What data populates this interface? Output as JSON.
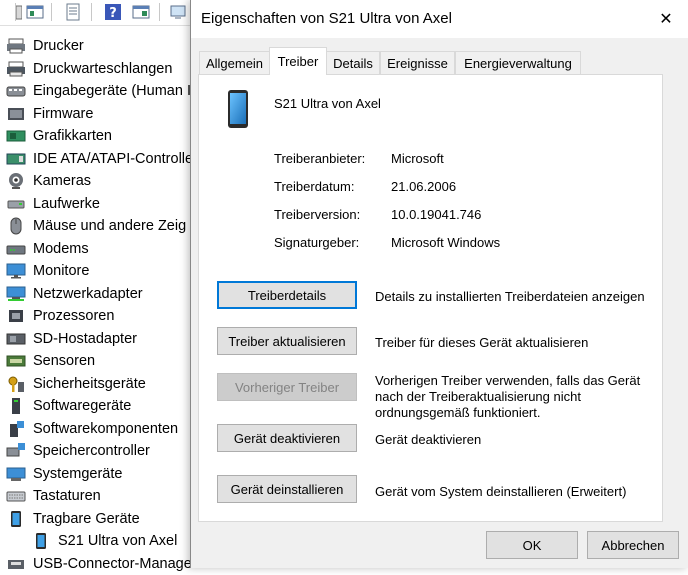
{
  "device_manager": {
    "tree_items": [
      {
        "label": "Drucker",
        "icon": "printer-icon"
      },
      {
        "label": "Druckwarteschlangen",
        "icon": "print-queue-icon"
      },
      {
        "label": "Eingabegeräte (Human I",
        "icon": "hid-icon"
      },
      {
        "label": "Firmware",
        "icon": "firmware-icon"
      },
      {
        "label": "Grafikkarten",
        "icon": "display-adapter-icon"
      },
      {
        "label": "IDE ATA/ATAPI-Controller",
        "icon": "ide-controller-icon"
      },
      {
        "label": "Kameras",
        "icon": "camera-icon"
      },
      {
        "label": "Laufwerke",
        "icon": "disk-drive-icon"
      },
      {
        "label": "Mäuse und andere Zeig",
        "icon": "mouse-icon"
      },
      {
        "label": "Modems",
        "icon": "modem-icon"
      },
      {
        "label": "Monitore",
        "icon": "monitor-icon"
      },
      {
        "label": "Netzwerkadapter",
        "icon": "network-adapter-icon"
      },
      {
        "label": "Prozessoren",
        "icon": "processor-icon"
      },
      {
        "label": "SD-Hostadapter",
        "icon": "sd-host-icon"
      },
      {
        "label": "Sensoren",
        "icon": "sensor-icon"
      },
      {
        "label": "Sicherheitsgeräte",
        "icon": "security-device-icon"
      },
      {
        "label": "Softwaregeräte",
        "icon": "software-device-icon"
      },
      {
        "label": "Softwarekomponenten",
        "icon": "software-component-icon"
      },
      {
        "label": "Speichercontroller",
        "icon": "storage-controller-icon"
      },
      {
        "label": "Systemgeräte",
        "icon": "system-device-icon"
      },
      {
        "label": "Tastaturen",
        "icon": "keyboard-icon"
      },
      {
        "label": "Tragbare Geräte",
        "icon": "portable-device-icon"
      },
      {
        "label": "S21 Ultra von Axel",
        "icon": "phone-icon"
      },
      {
        "label": "USB-Connector-Manage",
        "icon": "usb-connector-icon"
      }
    ]
  },
  "dialog": {
    "title": "Eigenschaften von S21 Ultra von Axel",
    "close_symbol": "✕",
    "tabs": [
      {
        "label": "Allgemein"
      },
      {
        "label": "Treiber"
      },
      {
        "label": "Details"
      },
      {
        "label": "Ereignisse"
      },
      {
        "label": "Energieverwaltung"
      }
    ],
    "active_tab": "Treiber",
    "device_name": "S21 Ultra von Axel",
    "properties": [
      {
        "label": "Treiberanbieter:",
        "value": "Microsoft"
      },
      {
        "label": "Treiberdatum:",
        "value": "21.06.2006"
      },
      {
        "label": "Treiberversion:",
        "value": "10.0.19041.746"
      },
      {
        "label": "Signaturgeber:",
        "value": "Microsoft Windows"
      }
    ],
    "actions": [
      {
        "button": "Treiberdetails",
        "description": "Details zu installierten Treiberdateien anzeigen"
      },
      {
        "button": "Treiber aktualisieren",
        "description": "Treiber für dieses Gerät aktualisieren"
      },
      {
        "button": "Vorheriger Treiber",
        "description": "Vorherigen Treiber verwenden, falls das Gerät nach der Treiberaktualisierung nicht ordnungsgemäß funktioniert."
      },
      {
        "button": "Gerät deaktivieren",
        "description": "Gerät deaktivieren"
      },
      {
        "button": "Gerät deinstallieren",
        "description": "Gerät vom System deinstallieren (Erweitert)"
      }
    ],
    "ok_label": "OK",
    "cancel_label": "Abbrechen",
    "colors": {
      "focus": "#0078d7",
      "dialog_bg": "#f0f0f0",
      "button_bg": "#e1e1e1"
    }
  }
}
